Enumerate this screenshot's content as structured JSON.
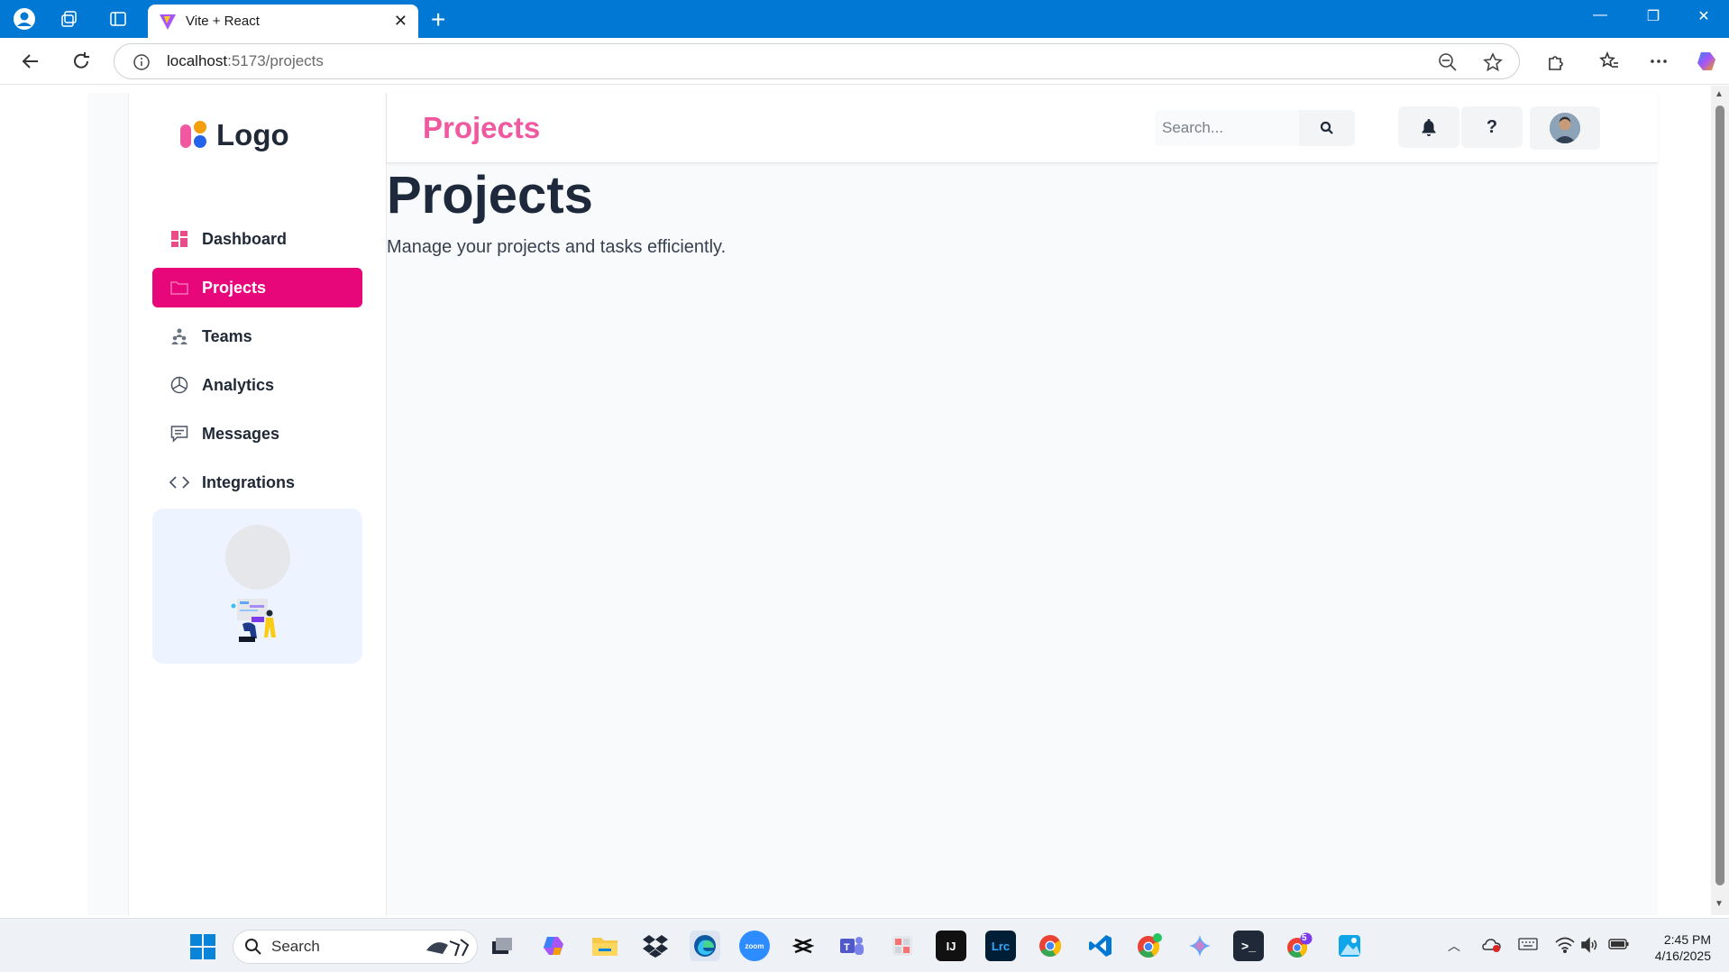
{
  "browser": {
    "tab_title": "Vite + React",
    "url_host": "localhost",
    "url_path": ":5173/projects"
  },
  "sidebar": {
    "logo_text": "Logo",
    "items": [
      {
        "label": "Dashboard",
        "icon": "grid-icon",
        "active": false
      },
      {
        "label": "Projects",
        "icon": "folder-icon",
        "active": true
      },
      {
        "label": "Teams",
        "icon": "team-icon",
        "active": false
      },
      {
        "label": "Analytics",
        "icon": "pie-chart-icon",
        "active": false
      },
      {
        "label": "Messages",
        "icon": "message-icon",
        "active": false
      },
      {
        "label": "Integrations",
        "icon": "code-icon",
        "active": false
      }
    ]
  },
  "header": {
    "title": "Projects",
    "search_placeholder": "Search...",
    "help_label": "?"
  },
  "main": {
    "heading": "Projects",
    "subtitle": "Manage your projects and tasks efficiently."
  },
  "taskbar": {
    "search_label": "Search",
    "time": "2:45 PM",
    "date": "4/16/2025",
    "chrome_badge": "5"
  },
  "colors": {
    "browser_accent": "#0078d4",
    "active_item": "#e8077a",
    "header_title": "#f0589f",
    "heading": "#1e293b"
  }
}
